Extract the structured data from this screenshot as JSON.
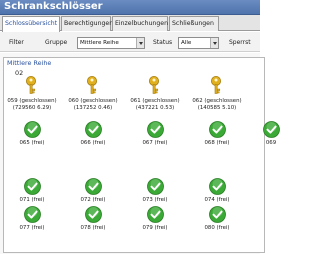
{
  "window": {
    "title": "Schrankschlösser"
  },
  "tabs": [
    {
      "label": "Schlossübersicht",
      "active": true
    },
    {
      "label": "Berechtigungen",
      "active": false
    },
    {
      "label": "Einzelbuchungen",
      "active": false
    },
    {
      "label": "Schließungen",
      "active": false
    }
  ],
  "filter": {
    "label": "Filter",
    "group_label": "Gruppe",
    "group_value": "Mittlere Reihe",
    "status_label": "Status",
    "status_value": "Alle",
    "truncated_label": "Sperrst"
  },
  "group": {
    "title": "Mittlere Reihe",
    "row_code": "02",
    "colors": {
      "key": "#e1b01e",
      "ok": "#3aa935"
    },
    "locks": [
      {
        "icon": "key-icon",
        "line1": "059 (geschlossen)",
        "line2": "(729560 6.29)"
      },
      {
        "icon": "key-icon",
        "line1": "060 (geschlossen)",
        "line2": "(137252 0.46)"
      },
      {
        "icon": "key-icon",
        "line1": "061 (geschlossen)",
        "line2": "(437221 0.53)"
      },
      {
        "icon": "key-icon",
        "line1": "062 (geschlossen)",
        "line2": "(140585 5.10)"
      },
      {
        "icon": "checkmark-icon",
        "line1": "065 (frei)"
      },
      {
        "icon": "checkmark-icon",
        "line1": "066 (frei)"
      },
      {
        "icon": "checkmark-icon",
        "line1": "067 (frei)"
      },
      {
        "icon": "checkmark-icon",
        "line1": "068 (frei)"
      },
      {
        "icon": "checkmark-icon",
        "line1": "069"
      },
      {
        "icon": "checkmark-icon",
        "line1": "071 (frei)"
      },
      {
        "icon": "checkmark-icon",
        "line1": "072 (frei)"
      },
      {
        "icon": "checkmark-icon",
        "line1": "073 (frei)"
      },
      {
        "icon": "checkmark-icon",
        "line1": "074 (frei)"
      },
      {
        "icon": "checkmark-icon",
        "line1": "077 (frei)"
      },
      {
        "icon": "checkmark-icon",
        "line1": "078 (frei)"
      },
      {
        "icon": "checkmark-icon",
        "line1": "079 (frei)"
      },
      {
        "icon": "checkmark-icon",
        "line1": "080 (frei)"
      }
    ]
  }
}
